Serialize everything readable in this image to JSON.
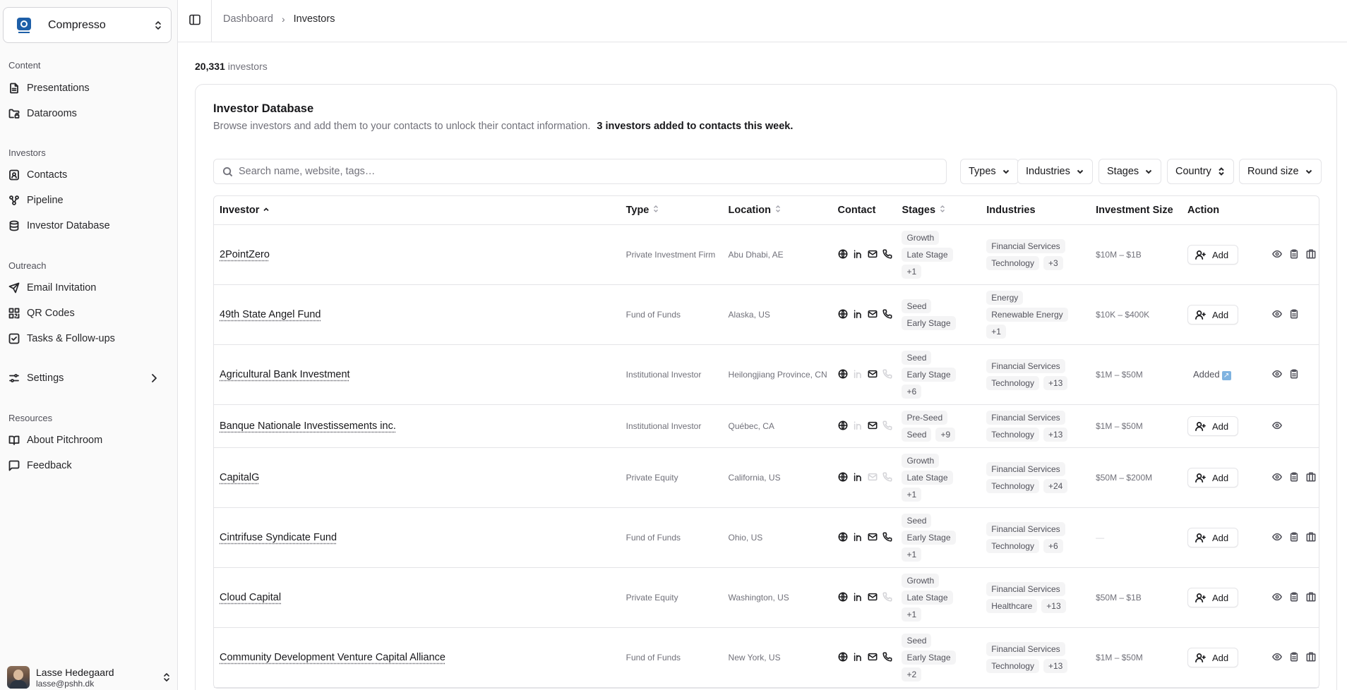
{
  "workspace": {
    "name": "Compresso",
    "logo_icon": "compresso-logo-icon"
  },
  "sidebar": {
    "groups": [
      {
        "label": "Content",
        "items": [
          {
            "label": "Presentations",
            "icon": "file-icon"
          },
          {
            "label": "Datarooms",
            "icon": "folder-lock-icon"
          }
        ]
      },
      {
        "label": "Investors",
        "items": [
          {
            "label": "Contacts",
            "icon": "contact-icon"
          },
          {
            "label": "Pipeline",
            "icon": "workflow-icon"
          },
          {
            "label": "Investor Database",
            "icon": "database-icon"
          }
        ]
      },
      {
        "label": "Outreach",
        "items": [
          {
            "label": "Email Invitation",
            "icon": "send-icon"
          },
          {
            "label": "QR Codes",
            "icon": "qr-code-icon"
          },
          {
            "label": "Tasks & Follow-ups",
            "icon": "check-square-icon"
          }
        ]
      },
      {
        "label": "",
        "items": [
          {
            "label": "Settings",
            "icon": "settings-icon"
          }
        ]
      },
      {
        "label": "Resources",
        "items": [
          {
            "label": "About Pitchroom",
            "icon": "book-icon"
          },
          {
            "label": "Feedback",
            "icon": "message-icon"
          }
        ]
      }
    ],
    "user": {
      "name": "Lasse Hedegaard",
      "email": "lasse@pshh.dk"
    }
  },
  "breadcrumb": {
    "parent": "Dashboard",
    "separator": "›",
    "current": "Investors"
  },
  "count": {
    "number": "20,331",
    "label": "investors"
  },
  "card": {
    "title": "Investor Database",
    "subtitle": "Browse investors and add them to your contacts to unlock their contact information.",
    "highlight": "3 investors added to contacts this week."
  },
  "search": {
    "placeholder": "Search name, website, tags…",
    "value": ""
  },
  "filters": [
    "Types",
    "Industries",
    "Stages",
    "Country",
    "Round size"
  ],
  "table": {
    "columns": [
      "Investor",
      "Type",
      "Location",
      "Contact",
      "Stages",
      "Industries",
      "Investment Size",
      "Action"
    ],
    "add_label": "Add",
    "added_label": "Added",
    "rows": [
      {
        "name": "2PointZero",
        "type": "Private Investment Firm",
        "location": "Abu Dhabi, AE",
        "stages": [
          "Growth",
          "Late Stage"
        ],
        "stages_more": "+1",
        "industries": [
          "Financial Services",
          "Technology"
        ],
        "industries_more": "+3",
        "size": "$10M – $1B",
        "status": "add"
      },
      {
        "name": "49th State Angel Fund",
        "type": "Fund of Funds",
        "location": "Alaska, US",
        "stages": [
          "Seed",
          "Early Stage"
        ],
        "stages_more": "",
        "industries": [
          "Energy",
          "Renewable Energy"
        ],
        "industries_more": "+1",
        "size": "$10K – $400K",
        "status": "add"
      },
      {
        "name": "Agricultural Bank Investment",
        "type": "Institutional Investor",
        "location": "Heilongjiang Province, CN",
        "stages": [
          "Seed",
          "Early Stage"
        ],
        "stages_more": "+6",
        "industries": [
          "Financial Services",
          "Technology"
        ],
        "industries_more": "+13",
        "size": "$1M – $50M",
        "status": "added"
      },
      {
        "name": "Banque Nationale Investissements inc.",
        "type": "Institutional Investor",
        "location": "Québec, CA",
        "stages": [
          "Pre-Seed",
          "Seed"
        ],
        "stages_more": "+9",
        "industries": [
          "Financial Services",
          "Technology"
        ],
        "industries_more": "+13",
        "size": "$1M – $50M",
        "status": "add"
      },
      {
        "name": "CapitalG",
        "type": "Private Equity",
        "location": "California, US",
        "stages": [
          "Growth",
          "Late Stage"
        ],
        "stages_more": "+1",
        "industries": [
          "Financial Services",
          "Technology"
        ],
        "industries_more": "+24",
        "size": "$50M – $200M",
        "status": "add"
      },
      {
        "name": "Cintrifuse Syndicate Fund",
        "type": "Fund of Funds",
        "location": "Ohio, US",
        "stages": [
          "Seed",
          "Early Stage"
        ],
        "stages_more": "+1",
        "industries": [
          "Financial Services",
          "Technology"
        ],
        "industries_more": "+6",
        "size": "—",
        "status": "add"
      },
      {
        "name": "Cloud Capital",
        "type": "Private Equity",
        "location": "Washington, US",
        "stages": [
          "Growth",
          "Late Stage"
        ],
        "stages_more": "+1",
        "industries": [
          "Financial Services",
          "Healthcare"
        ],
        "industries_more": "+13",
        "size": "$50M – $1B",
        "status": "add"
      },
      {
        "name": "Community Development Venture Capital Alliance",
        "type": "Fund of Funds",
        "location": "New York, US",
        "stages": [
          "Seed",
          "Early Stage"
        ],
        "stages_more": "+2",
        "industries": [
          "Financial Services",
          "Technology"
        ],
        "industries_more": "+13",
        "size": "$1M – $50M",
        "status": "add"
      }
    ]
  }
}
